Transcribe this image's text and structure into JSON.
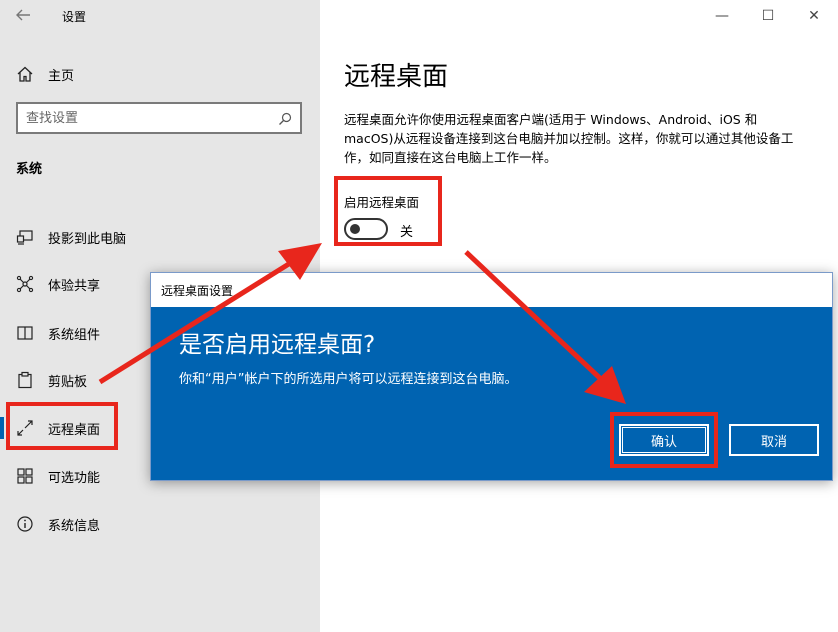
{
  "window": {
    "app_title": "设置",
    "back_icon": "back-arrow-icon",
    "controls": {
      "minimize": "—",
      "maximize": "☐",
      "close": "✕"
    }
  },
  "sidebar": {
    "home_label": "主页",
    "search_placeholder": "查找设置",
    "section_title": "系统",
    "items": [
      {
        "label": "投影到此电脑",
        "icon": "projector-icon"
      },
      {
        "label": "体验共享",
        "icon": "share-icon"
      },
      {
        "label": "系统组件",
        "icon": "components-icon"
      },
      {
        "label": "剪贴板",
        "icon": "clipboard-icon"
      },
      {
        "label": "远程桌面",
        "icon": "remote-desktop-icon",
        "active": true
      },
      {
        "label": "可选功能",
        "icon": "optional-features-icon"
      },
      {
        "label": "系统信息",
        "icon": "info-icon"
      }
    ]
  },
  "main": {
    "title": "远程桌面",
    "description": "远程桌面允许你使用远程桌面客户端(适用于 Windows、Android、iOS 和 macOS)从远程设备连接到这台电脑并加以控制。这样，你就可以通过其他设备工作，如同直接在这台电脑上工作一样。",
    "toggle_label": "启用远程桌面",
    "toggle_state": "关"
  },
  "dialog": {
    "title": "远程桌面设置",
    "heading": "是否启用远程桌面?",
    "message": "你和“用户”帐户下的所选用户将可以远程连接到这台电脑。",
    "confirm_label": "确认",
    "cancel_label": "取消"
  },
  "colors": {
    "accent": "#0063b1",
    "annotation": "#e8261c",
    "sidebar_bg": "#e6e6e6"
  }
}
